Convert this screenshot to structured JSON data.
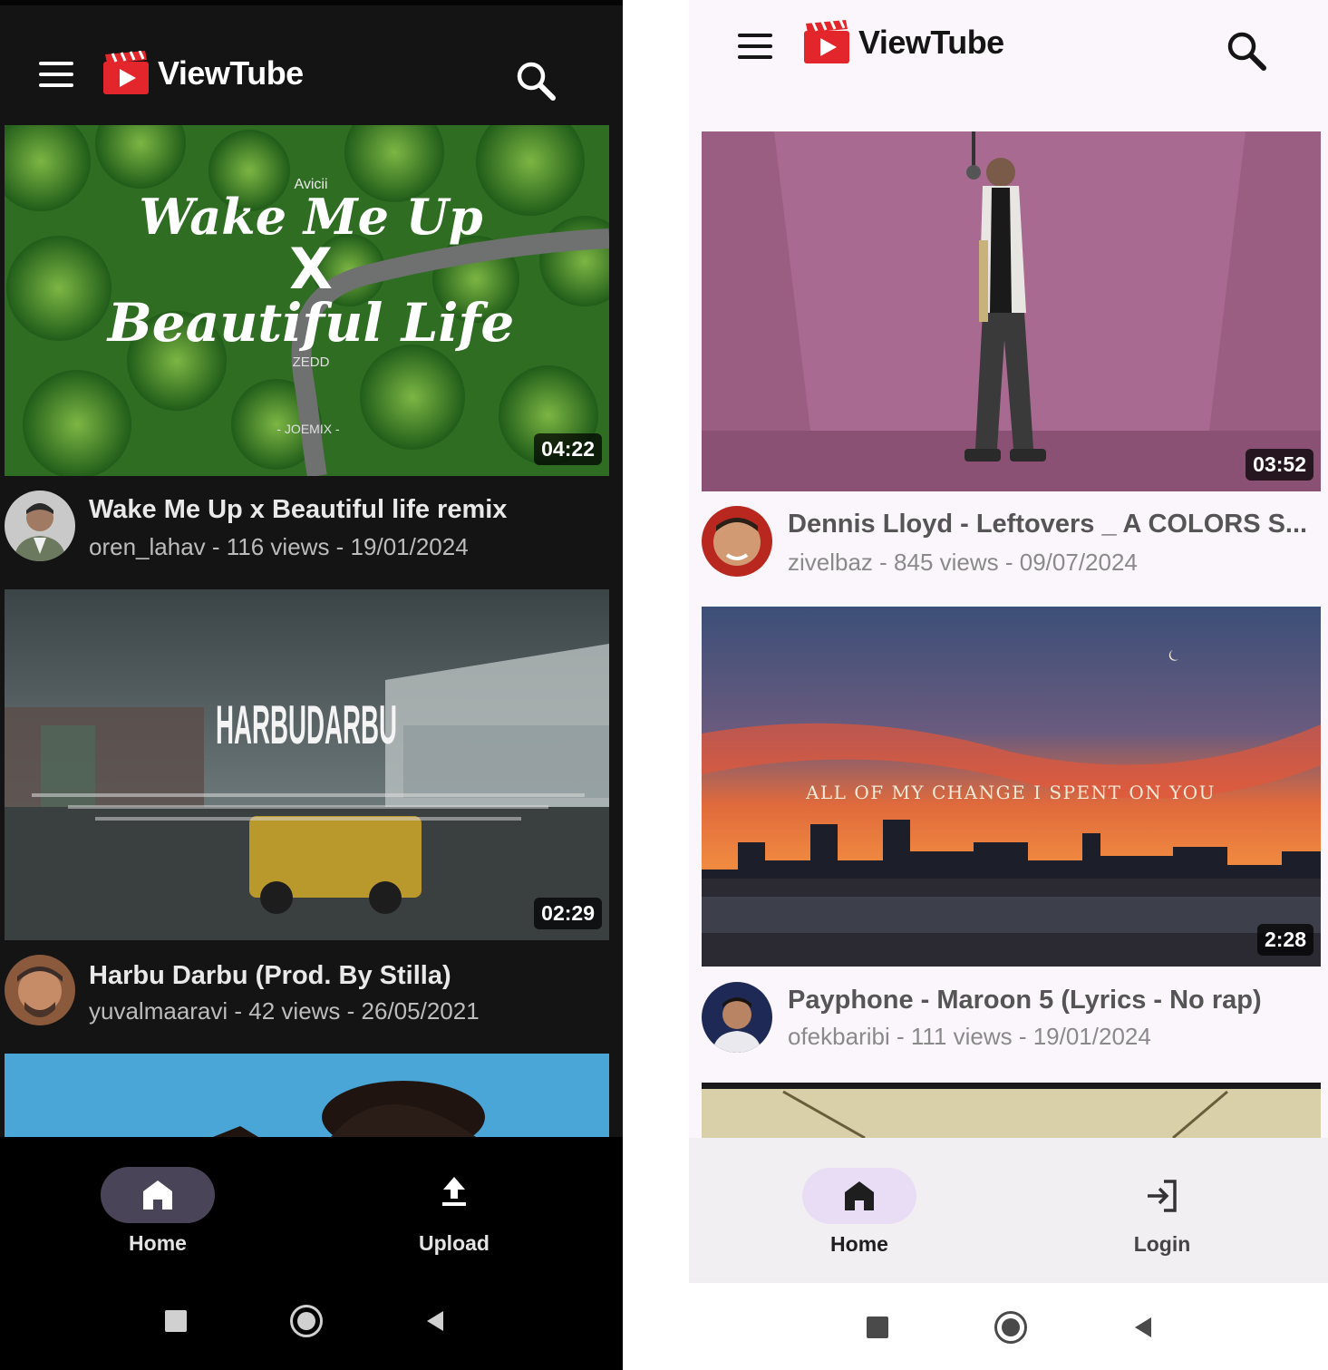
{
  "dark_screen": {
    "app_name": "ViewTube",
    "videos": [
      {
        "title": "Wake Me Up x Beautiful life remix",
        "meta": "oren_lahav - 116 views - 19/01/2024",
        "duration": "04:22",
        "thumbnail_text": {
          "top": "Avicii",
          "line1": "Wake Me Up",
          "x": "X",
          "line2": "Beautiful Life",
          "bottom": "ZEDD",
          "credit": "- JOEMIX -"
        }
      },
      {
        "title": "Harbu Darbu (Prod. By Stilla)",
        "meta": "yuvalmaaravi - 42 views - 26/05/2021",
        "duration": "02:29",
        "thumbnail_text": {
          "title": "HARBUDARBU"
        }
      }
    ],
    "nav": [
      {
        "label": "Home",
        "icon": "home-icon",
        "active": true
      },
      {
        "label": "Upload",
        "icon": "upload-icon",
        "active": false
      }
    ]
  },
  "light_screen": {
    "app_name": "ViewTube",
    "videos": [
      {
        "title": "Dennis Lloyd - Leftovers _ A COLORS S...",
        "meta": "zivelbaz - 845 views - 09/07/2024",
        "duration": "03:52"
      },
      {
        "title": "Payphone - Maroon 5 (Lyrics - No rap)",
        "meta": "ofekbaribi - 111 views - 19/01/2024",
        "duration": "2:28",
        "thumbnail_text": {
          "caption": "ALL OF MY CHANGE I SPENT ON YOU"
        }
      }
    ],
    "nav": [
      {
        "label": "Home",
        "icon": "home-icon",
        "active": true
      },
      {
        "label": "Login",
        "icon": "login-icon",
        "active": false
      }
    ]
  },
  "colors": {
    "brand_red": "#e3262b",
    "dark_bg": "#141414",
    "light_bg": "#fbf6fc",
    "dark_active_pill": "#4a4458",
    "light_active_pill": "#e9ddf6"
  }
}
